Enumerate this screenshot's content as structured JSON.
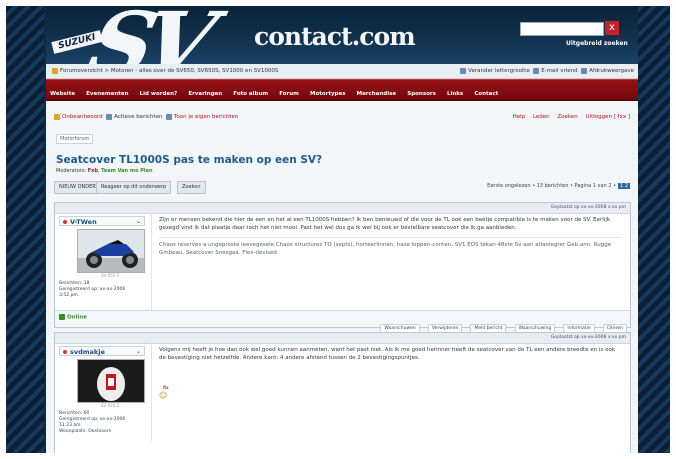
{
  "header": {
    "logo_sv": "SV",
    "logo_suzuki": "SUZUKI",
    "logo_contact": "contact.com",
    "search_button": "x",
    "advanced_search": "Uitgebreid zoeken"
  },
  "breadcrumb": {
    "text": "Forumoverzicht > Motoren - alles over de SV650, SV650S, SV1000 en SV1000S",
    "recent": "Verander lettergrootte",
    "email": "E-mail vriend",
    "print": "Afdrukweergave"
  },
  "navbar": {
    "items": [
      "Website",
      "Evenementen",
      "Lid worden?",
      "Ervaringen",
      "Foto album",
      "Forum",
      "Motortypes",
      "Merchandise",
      "Sponsors",
      "Links",
      "Contact"
    ]
  },
  "userbar": {
    "unanswered": "Onbeantwoord",
    "active": "Actieve berichten",
    "own_posts": "Toon je eigen berichten",
    "help": "Help",
    "members": "Leden",
    "search": "Zoeken",
    "logout": "Uitloggen [ fxx ]"
  },
  "topic": {
    "crumb": "Motorforum",
    "title": "Seatcover TL1000S pas te maken op een SV?",
    "moderators_label": "Moderators:",
    "moderator1": "Fxb",
    "moderator2": "Team Van mo Plen",
    "new_topic": "NIEUW ONDERWERP",
    "reply": "Reageer op dit onderwerp",
    "search_topic": "Zoeken",
    "page_info": "Eerste ongelezen • 13 berichten • Pagina 1 van 2 •",
    "page_num": "1 2"
  },
  "posts": [
    {
      "date": "Geplaatst op xx-xx-2008 x:xx pm",
      "username": "V-TWen",
      "avatar_caption": "SV 650 S",
      "info_lines": [
        "Berichten: 38",
        "Geregistreerd op: xx-xx-2006",
        "3:52 pm"
      ],
      "message": "Zijn er mensen bekend die hier de een en het al een TL1000S hebben? Ik ben benieuwd of die voor de TL ook een beetje compatible is te maken voor de SV. Eerlijk gezegd vind ik dat plaatje daar toch het niet mooi. Past het wel dus ga ik wel bij ook er bestelbare seatcover die ik ga aanbieden.",
      "signature": "Chaos reserves a ungeproste leevegesele Chaos structures TO (septs), horteerlinnen, hase loppen-conten, SV1 EOS tekan 48ste Sv aan atlastegter Geb.ann. Rugge Gmbeau, Seatcover Snesgaa. Flex-devised",
      "status": "Online",
      "actions": [
        "Waarschuwen",
        "Verwijderen",
        "Meld bericht",
        "Waarschuwing",
        "Informatie",
        "Citeren"
      ]
    },
    {
      "date": "Geplaatst op xx-xx-2008 x:xx pm",
      "username": "svdmakje",
      "avatar_caption": "SV 650 S",
      "info_lines": [
        "Berichten: 60",
        "Geregistreerd op: xx-xx-2006",
        "11:23 am",
        "Woonplaats: Oostvoorn"
      ],
      "message": "Volgens mij heeft je hoe dan ook wel goed kunnen aanmeten, want het past niet. Als ik me goed herinner heeft de seatcover van de TL een andere breedte en is ook de bevestiging niet hetzelfde. Andere kant: 4 andere afstand tussen de 2 bevestigingspuntjes.",
      "emoji_label": "fix"
    }
  ],
  "colors": {
    "header_bg": "#0a2338",
    "navbar_red": "#8b0f14",
    "title_blue": "#1f5b8a",
    "online_green": "#3a8a2a"
  }
}
